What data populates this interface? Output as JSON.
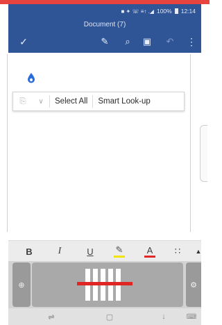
{
  "status_bar": {
    "indicators": "■ ✦ ☏ ≡↑ .◢",
    "battery": "100%",
    "time": "12:14"
  },
  "title_bar": {
    "title": "Document (7)"
  },
  "toolbar": {
    "icons": [
      "check-icon",
      "pen-icon",
      "search-icon",
      "save-icon",
      "undo-icon",
      "more-icon"
    ],
    "check_glyph": "✓",
    "pen_glyph": "✎",
    "search_glyph": "⌕",
    "save_glyph": "▣",
    "undo_glyph": "↶",
    "more_glyph": "⋮"
  },
  "context_menu": {
    "paste_glyph": "⎘",
    "chevron_glyph": "∨",
    "select_all": "Select All",
    "smart_lookup": "Smart Look-up"
  },
  "format_bar": {
    "bold": "B",
    "italic": "I",
    "underline": "U",
    "highlight_glyph": "✎",
    "font_color": "A",
    "list_glyph": "∷",
    "caret_glyph": "▲"
  },
  "keyboard": {
    "globe_glyph": "⊕",
    "settings_glyph": "⚙"
  },
  "nav_bar": {
    "recent_glyph": "⇌",
    "home_glyph": "▢",
    "back_glyph": "↓",
    "keyboard_glyph": "⌨"
  },
  "colors": {
    "accent": "#2f5597",
    "top_strip": "#e7443f",
    "highlight_bar": "#f2e300",
    "font_color_bar": "#e0282b",
    "cursor_handle": "#2b6cdc",
    "keyboard_line": "#e12522"
  }
}
